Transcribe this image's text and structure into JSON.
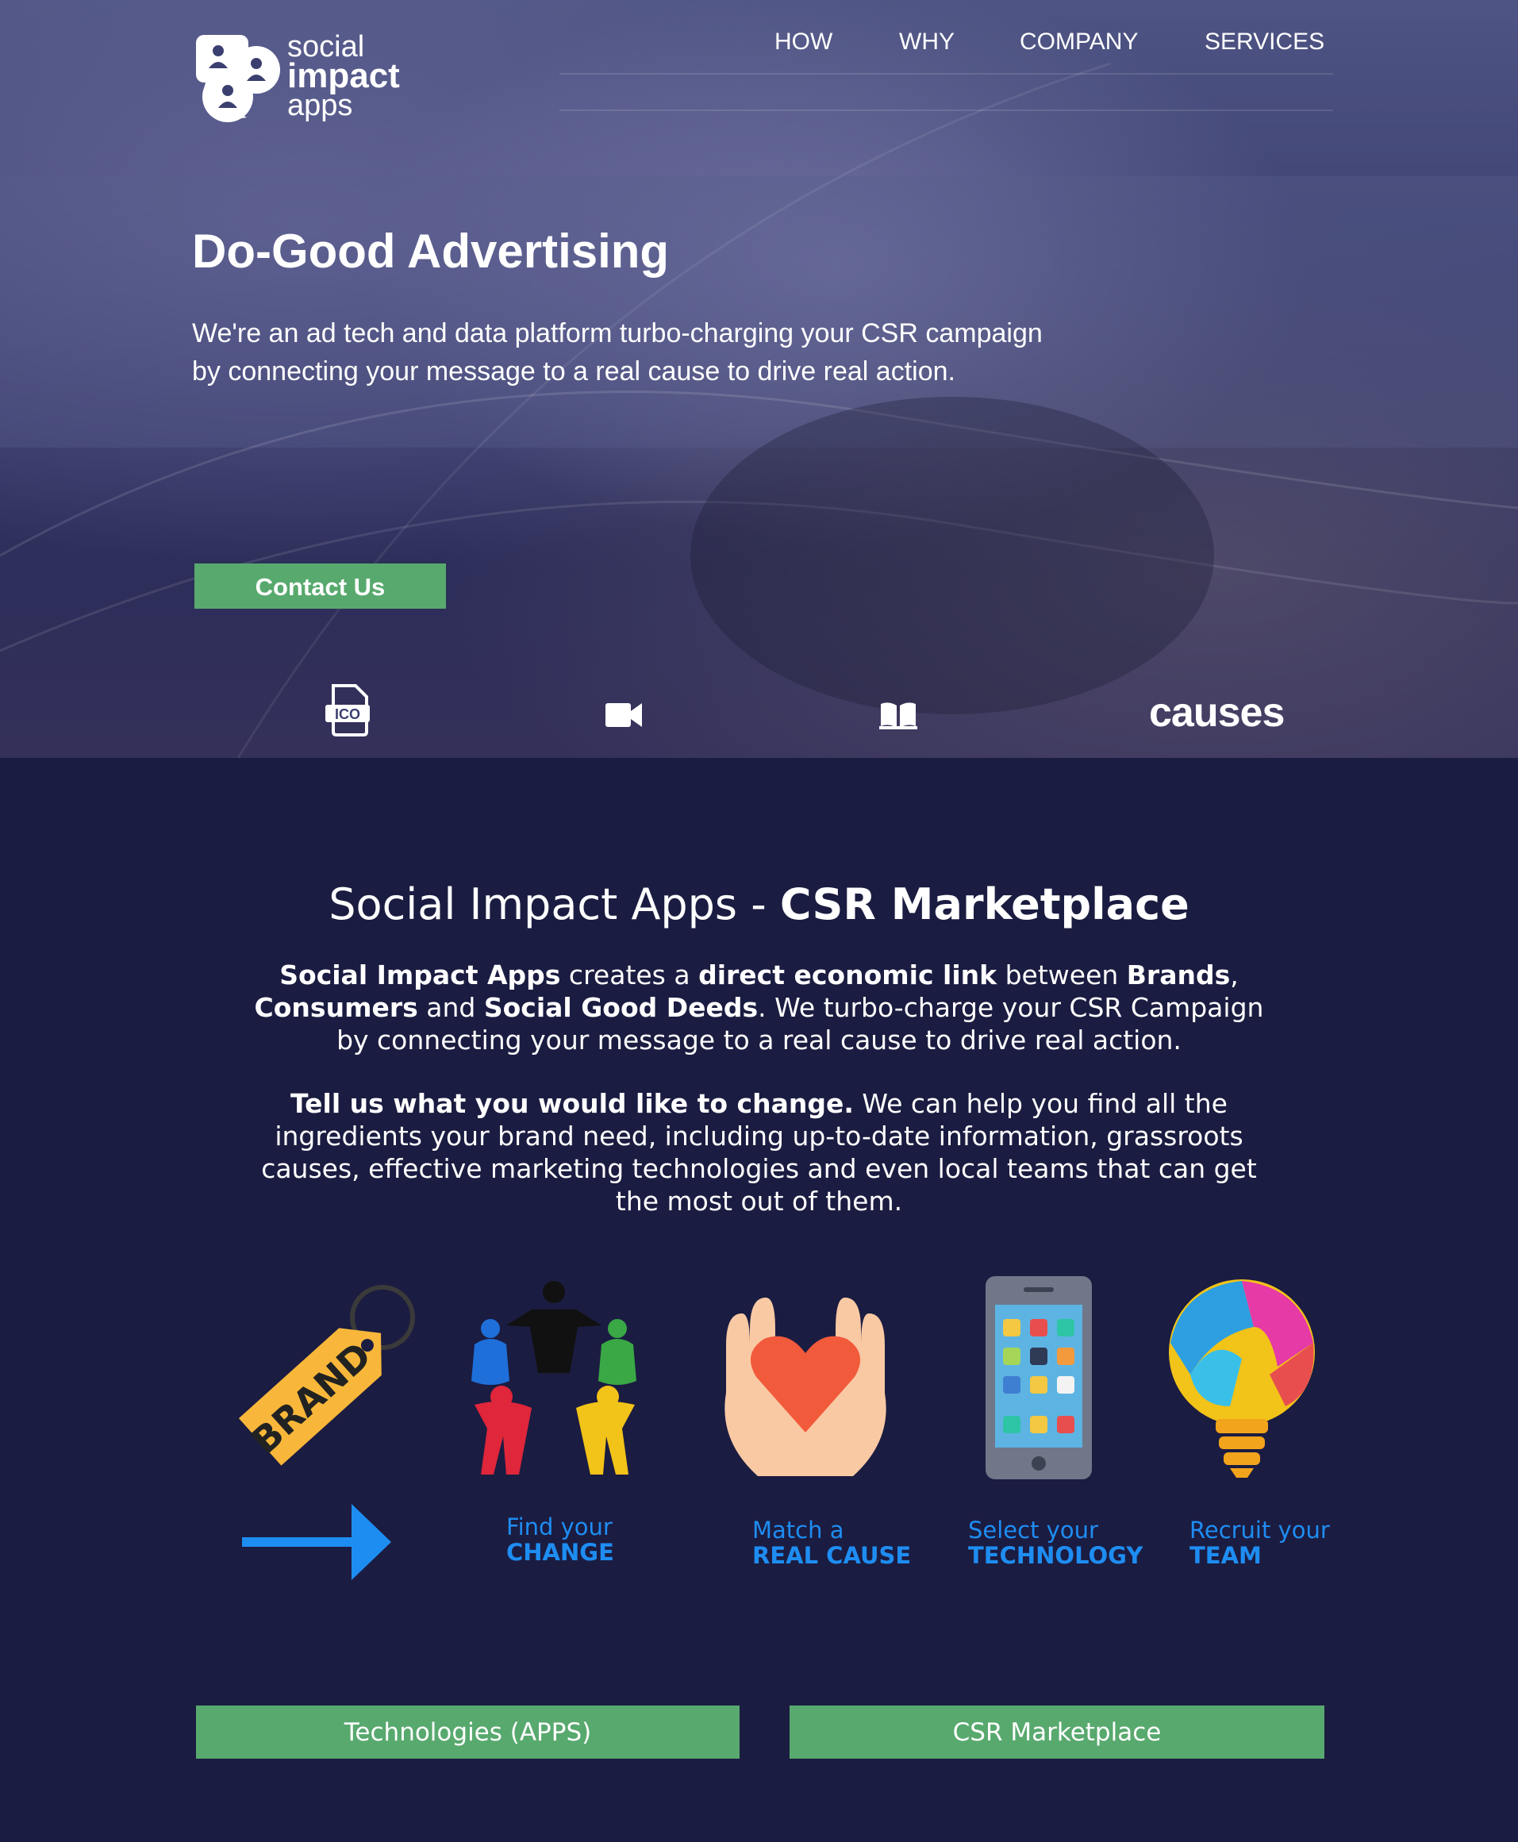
{
  "brand": {
    "line1": "social",
    "line2": "impact",
    "line3": "apps"
  },
  "nav": {
    "items": [
      "HOW",
      "WHY",
      "COMPANY",
      "SERVICES"
    ]
  },
  "hero": {
    "title": "Do-Good Advertising",
    "subtitle_line1": "We're an ad tech and data platform turbo-charging your CSR campaign",
    "subtitle_line2": "by connecting your message to a real cause to drive real action.",
    "cta": "Contact Us",
    "icons": [
      "ico-file-icon",
      "video-camera-icon",
      "open-book-icon"
    ],
    "causes_logo": "causes"
  },
  "marketplace": {
    "heading_light": "Social Impact Apps - ",
    "heading_bold": "CSR Marketplace",
    "p1": {
      "b1": "Social Impact Apps",
      "t1": " creates a ",
      "b2": "direct economic link",
      "t2": " between ",
      "b3": "Brands",
      "t3": ", ",
      "b4": "Consumers",
      "t4": " and ",
      "b5": "Social Good Deeds",
      "t5": ". We turbo-charge your CSR Campaign by connecting your message to a real cause to drive real action."
    },
    "p2": {
      "b1": "Tell us what you would like to change.",
      "t1": " We can help you find all the ingredients your brand need, including up-to-date information, grassroots causes, effective marketing technologies and even local teams that can get the most out of them."
    },
    "brand_tag_text": "BRAND",
    "steps": [
      {
        "line1": "Find your",
        "line2": "CHANGE"
      },
      {
        "line1": "Match a",
        "line2": "REAL CAUSE"
      },
      {
        "line1": "Select your",
        "line2": "TECHNOLOGY"
      },
      {
        "line1": "Recruit your",
        "line2": "TEAM"
      }
    ],
    "buttons": {
      "technologies": "Technologies (APPS)",
      "marketplace": "CSR Marketplace"
    }
  },
  "colors": {
    "background": "#1b1c41",
    "button_green": "#58a96e",
    "accent_blue": "#1e8df2"
  }
}
